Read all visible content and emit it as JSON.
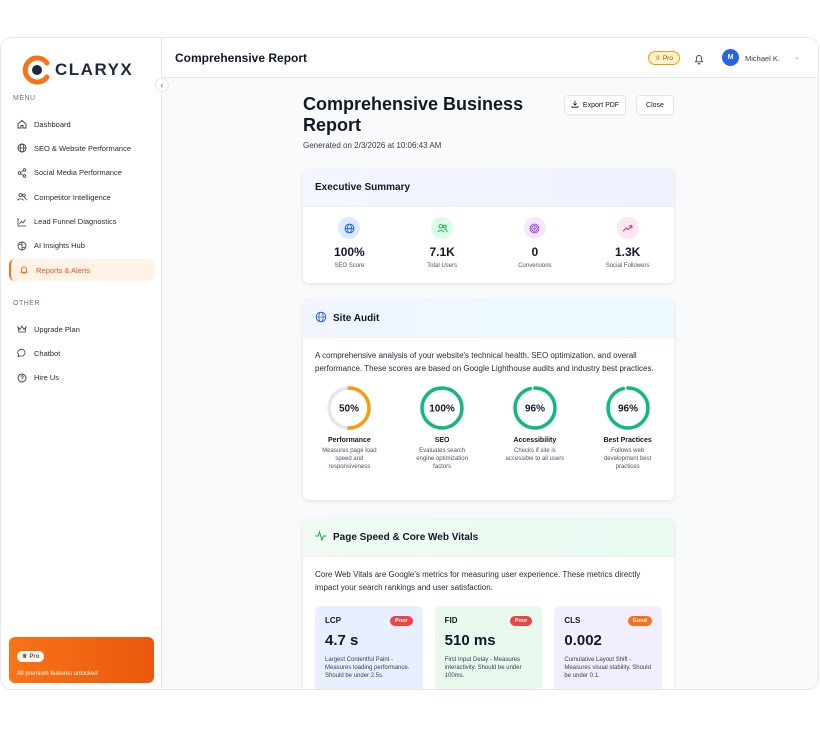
{
  "brand": {
    "name": "CLARYX"
  },
  "sidebar": {
    "menu_label": "MENU",
    "items": [
      {
        "label": "Dashboard",
        "icon": "home-icon"
      },
      {
        "label": "SEO & Website Performance",
        "icon": "globe-icon"
      },
      {
        "label": "Social Media Performance",
        "icon": "share-icon"
      },
      {
        "label": "Competitor Intelligence",
        "icon": "users-icon"
      },
      {
        "label": "Lead Funnel Diagnostics",
        "icon": "chart-line-icon"
      },
      {
        "label": "AI Insights Hub",
        "icon": "ai-icon"
      },
      {
        "label": "Reports & Alerts",
        "icon": "bell-icon",
        "active": true
      }
    ],
    "other_label": "OTHER",
    "other_items": [
      {
        "label": "Upgrade Plan",
        "icon": "crown-icon"
      },
      {
        "label": "Chatbot",
        "icon": "chat-icon"
      },
      {
        "label": "Hire Us",
        "icon": "help-icon"
      }
    ],
    "pro_card": {
      "badge": "Pro",
      "message": "All premium features unlocked"
    }
  },
  "topbar": {
    "title": "Comprehensive Report",
    "plan_badge": "Pro",
    "user": {
      "initial": "M",
      "name": "Michael K."
    }
  },
  "report": {
    "title": "Comprehensive Business Report",
    "generated": "Generated on 2/3/2026 at 10:06:43 AM",
    "export_label": "Export PDF",
    "close_label": "Close",
    "executive_summary": {
      "heading": "Executive Summary",
      "stats": [
        {
          "value": "100%",
          "label": "SEO Score",
          "icon": "globe-icon",
          "color": "#2563eb",
          "bg": "#dbeafe"
        },
        {
          "value": "7.1K",
          "label": "Total Users",
          "icon": "users-icon",
          "color": "#16a34a",
          "bg": "#dcfce7"
        },
        {
          "value": "0",
          "label": "Conversions",
          "icon": "target-icon",
          "color": "#9333ea",
          "bg": "#f3e8ff"
        },
        {
          "value": "1.3K",
          "label": "Social Followers",
          "icon": "trend-up-icon",
          "color": "#db2777",
          "bg": "#fce7f3"
        }
      ]
    },
    "site_audit": {
      "heading": "Site Audit",
      "description": "A comprehensive analysis of your website's technical health, SEO optimization, and overall performance. These scores are based on Google Lighthouse audits and industry best practices.",
      "scores": [
        {
          "value": 50,
          "display": "50%",
          "name": "Performance",
          "desc": "Measures page load speed and responsiveness",
          "color": "#f59e0b"
        },
        {
          "value": 100,
          "display": "100%",
          "name": "SEO",
          "desc": "Evaluates search engine optimization factors",
          "color": "#10b981"
        },
        {
          "value": 96,
          "display": "96%",
          "name": "Accessibility",
          "desc": "Checks if site is accessible to all users",
          "color": "#10b981"
        },
        {
          "value": 96,
          "display": "96%",
          "name": "Best Practices",
          "desc": "Follows web development best practices",
          "color": "#10b981"
        }
      ]
    },
    "page_speed": {
      "heading": "Page Speed & Core Web Vitals",
      "description": "Core Web Vitals are Google's metrics for measuring user experience. These metrics directly impact your search rankings and user satisfaction.",
      "vitals": [
        {
          "name": "LCP",
          "badge": "Poor",
          "value": "4.7 s",
          "desc": "Largest Contentful Paint - Measures loading performance. Should be under 2.5s.",
          "bg": "#e8f0ff",
          "badge_color": "#ef4444"
        },
        {
          "name": "FID",
          "badge": "Poor",
          "value": "510 ms",
          "desc": "First Input Delay - Measures interactivity. Should be under 100ms.",
          "bg": "#e9f9ee",
          "badge_color": "#ef4444"
        },
        {
          "name": "CLS",
          "badge": "Good",
          "value": "0.002",
          "desc": "Cumulative Layout Shift - Measures visual stability. Should be under 0.1.",
          "bg": "#f3eefe",
          "badge_color": "#f97316"
        }
      ]
    }
  }
}
